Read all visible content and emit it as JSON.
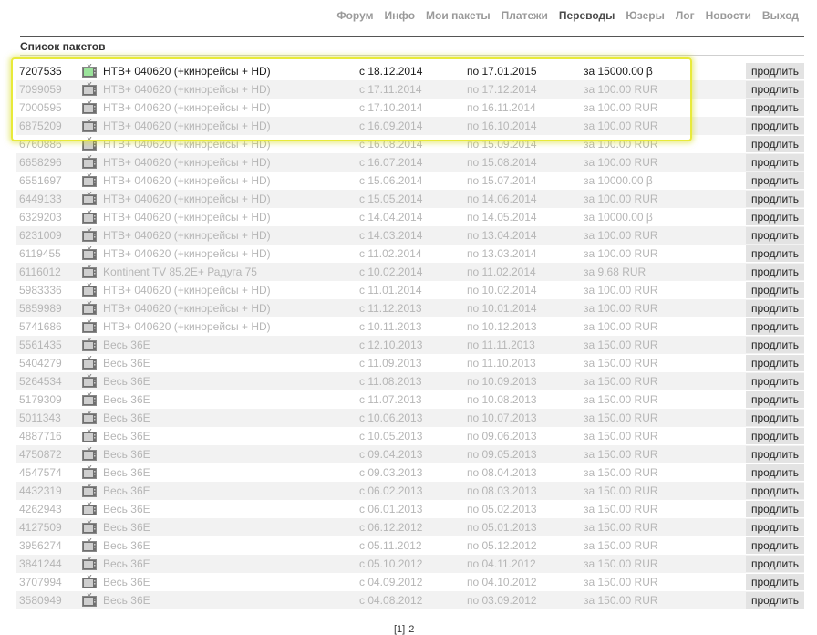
{
  "nav": [
    {
      "label": "Форум",
      "active": false
    },
    {
      "label": "Инфо",
      "active": false
    },
    {
      "label": "Мои пакеты",
      "active": false
    },
    {
      "label": "Платежи",
      "active": false
    },
    {
      "label": "Переводы",
      "active": true
    },
    {
      "label": "Юзеры",
      "active": false
    },
    {
      "label": "Лог",
      "active": false
    },
    {
      "label": "Новости",
      "active": false
    },
    {
      "label": "Выход",
      "active": false
    }
  ],
  "section_title": "Список пакетов",
  "renew_label": "продлить",
  "icon": "tv-icon",
  "colors": {
    "highlight": "#e8ea3a",
    "active_icon": "#9be39b",
    "inactive_icon": "#888888"
  },
  "packages": [
    {
      "id": "7207535",
      "name": "НТВ+ 040620 (+кинорейсы + HD)",
      "from": "с 18.12.2014",
      "to": "по 17.01.2015",
      "price": "за 15000.00 β",
      "active": true
    },
    {
      "id": "7099059",
      "name": "НТВ+ 040620 (+кинорейсы + HD)",
      "from": "с 17.11.2014",
      "to": "по 17.12.2014",
      "price": "за 100.00 RUR",
      "active": false
    },
    {
      "id": "7000595",
      "name": "НТВ+ 040620 (+кинорейсы + HD)",
      "from": "с 17.10.2014",
      "to": "по 16.11.2014",
      "price": "за 100.00 RUR",
      "active": false
    },
    {
      "id": "6875209",
      "name": "НТВ+ 040620 (+кинорейсы + HD)",
      "from": "с 16.09.2014",
      "to": "по 16.10.2014",
      "price": "за 100.00 RUR",
      "active": false
    },
    {
      "id": "6760886",
      "name": "НТВ+ 040620 (+кинорейсы + HD)",
      "from": "с 16.08.2014",
      "to": "по 15.09.2014",
      "price": "за 100.00 RUR",
      "active": false
    },
    {
      "id": "6658296",
      "name": "НТВ+ 040620 (+кинорейсы + HD)",
      "from": "с 16.07.2014",
      "to": "по 15.08.2014",
      "price": "за 100.00 RUR",
      "active": false
    },
    {
      "id": "6551697",
      "name": "НТВ+ 040620 (+кинорейсы + HD)",
      "from": "с 15.06.2014",
      "to": "по 15.07.2014",
      "price": "за 10000.00 β",
      "active": false
    },
    {
      "id": "6449133",
      "name": "НТВ+ 040620 (+кинорейсы + HD)",
      "from": "с 15.05.2014",
      "to": "по 14.06.2014",
      "price": "за 100.00 RUR",
      "active": false
    },
    {
      "id": "6329203",
      "name": "НТВ+ 040620 (+кинорейсы + HD)",
      "from": "с 14.04.2014",
      "to": "по 14.05.2014",
      "price": "за 10000.00 β",
      "active": false
    },
    {
      "id": "6231009",
      "name": "НТВ+ 040620 (+кинорейсы + HD)",
      "from": "с 14.03.2014",
      "to": "по 13.04.2014",
      "price": "за 100.00 RUR",
      "active": false
    },
    {
      "id": "6119455",
      "name": "НТВ+ 040620 (+кинорейсы + HD)",
      "from": "с 11.02.2014",
      "to": "по 13.03.2014",
      "price": "за 100.00 RUR",
      "active": false
    },
    {
      "id": "6116012",
      "name": "Kontinent TV 85.2E+ Радуга 75",
      "from": "с 10.02.2014",
      "to": "по 11.02.2014",
      "price": "за 9.68 RUR",
      "active": false
    },
    {
      "id": "5983336",
      "name": "НТВ+ 040620 (+кинорейсы + HD)",
      "from": "с 11.01.2014",
      "to": "по 10.02.2014",
      "price": "за 100.00 RUR",
      "active": false
    },
    {
      "id": "5859989",
      "name": "НТВ+ 040620 (+кинорейсы + HD)",
      "from": "с 11.12.2013",
      "to": "по 10.01.2014",
      "price": "за 100.00 RUR",
      "active": false
    },
    {
      "id": "5741686",
      "name": "НТВ+ 040620 (+кинорейсы + HD)",
      "from": "с 10.11.2013",
      "to": "по 10.12.2013",
      "price": "за 100.00 RUR",
      "active": false
    },
    {
      "id": "5561435",
      "name": "Весь 36E",
      "from": "с 12.10.2013",
      "to": "по 11.11.2013",
      "price": "за 150.00 RUR",
      "active": false
    },
    {
      "id": "5404279",
      "name": "Весь 36E",
      "from": "с 11.09.2013",
      "to": "по 11.10.2013",
      "price": "за 150.00 RUR",
      "active": false
    },
    {
      "id": "5264534",
      "name": "Весь 36E",
      "from": "с 11.08.2013",
      "to": "по 10.09.2013",
      "price": "за 150.00 RUR",
      "active": false
    },
    {
      "id": "5179309",
      "name": "Весь 36E",
      "from": "с 11.07.2013",
      "to": "по 10.08.2013",
      "price": "за 150.00 RUR",
      "active": false
    },
    {
      "id": "5011343",
      "name": "Весь 36E",
      "from": "с 10.06.2013",
      "to": "по 10.07.2013",
      "price": "за 150.00 RUR",
      "active": false
    },
    {
      "id": "4887716",
      "name": "Весь 36E",
      "from": "с 10.05.2013",
      "to": "по 09.06.2013",
      "price": "за 150.00 RUR",
      "active": false
    },
    {
      "id": "4750872",
      "name": "Весь 36E",
      "from": "с 09.04.2013",
      "to": "по 09.05.2013",
      "price": "за 150.00 RUR",
      "active": false
    },
    {
      "id": "4547574",
      "name": "Весь 36E",
      "from": "с 09.03.2013",
      "to": "по 08.04.2013",
      "price": "за 150.00 RUR",
      "active": false
    },
    {
      "id": "4432319",
      "name": "Весь 36E",
      "from": "с 06.02.2013",
      "to": "по 08.03.2013",
      "price": "за 150.00 RUR",
      "active": false
    },
    {
      "id": "4262943",
      "name": "Весь 36E",
      "from": "с 06.01.2013",
      "to": "по 05.02.2013",
      "price": "за 150.00 RUR",
      "active": false
    },
    {
      "id": "4127509",
      "name": "Весь 36E",
      "from": "с 06.12.2012",
      "to": "по 05.01.2013",
      "price": "за 150.00 RUR",
      "active": false
    },
    {
      "id": "3956274",
      "name": "Весь 36E",
      "from": "с 05.11.2012",
      "to": "по 05.12.2012",
      "price": "за 150.00 RUR",
      "active": false
    },
    {
      "id": "3841244",
      "name": "Весь 36E",
      "from": "с 05.10.2012",
      "to": "по 04.11.2012",
      "price": "за 150.00 RUR",
      "active": false
    },
    {
      "id": "3707994",
      "name": "Весь 36E",
      "from": "с 04.09.2012",
      "to": "по 04.10.2012",
      "price": "за 150.00 RUR",
      "active": false
    },
    {
      "id": "3580949",
      "name": "Весь 36E",
      "from": "с 04.08.2012",
      "to": "по 03.09.2012",
      "price": "за 150.00 RUR",
      "active": false
    }
  ],
  "pager": {
    "current": "[1]",
    "next": "2"
  }
}
